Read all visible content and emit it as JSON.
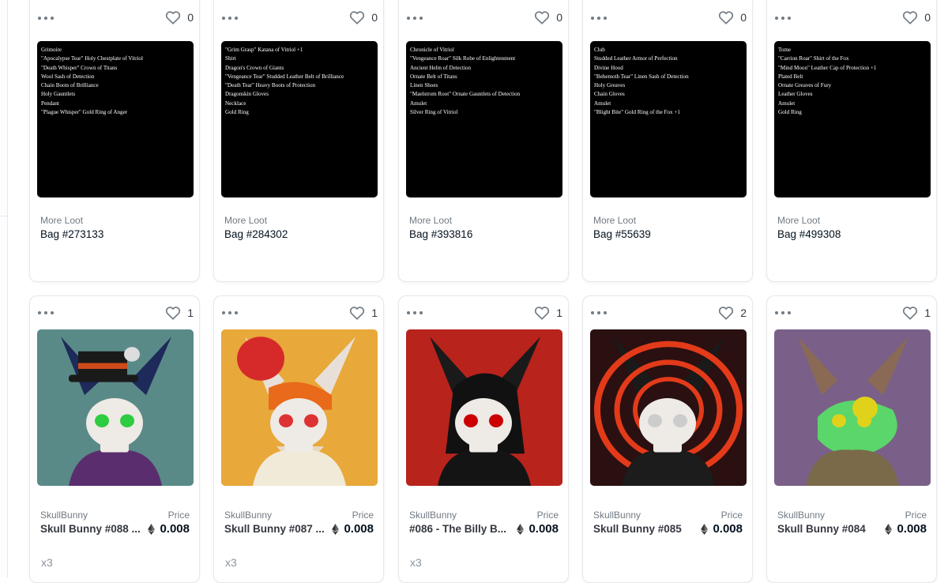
{
  "row1": [
    {
      "collection": "More Loot",
      "name": "Bag #273133",
      "likes": "0",
      "loot": [
        "Grimoire",
        "\"Apocalypse Tear\" Holy Chestplate of Vitriol",
        "\"Death Whisper\" Crown of Titans",
        "Wool Sash of Detection",
        "Chain Boots of Brilliance",
        "Holy Gauntlets",
        "Pendant",
        "\"Plague Whisper\" Gold Ring of Anger"
      ]
    },
    {
      "collection": "More Loot",
      "name": "Bag #284302",
      "likes": "0",
      "loot": [
        "\"Grim Grasp\" Katana of Vitriol +1",
        "Shirt",
        "Dragon's Crown of Giants",
        "\"Vengeance Tear\" Studded Leather Belt of Brilliance",
        "\"Death Tear\" Heavy Boots of Protection",
        "Dragonskin Gloves",
        "Necklace",
        "Gold Ring"
      ]
    },
    {
      "collection": "More Loot",
      "name": "Bag #393816",
      "likes": "0",
      "loot": [
        "Chronicle of Vitriol",
        "\"Vengeance Roar\" Silk Robe of Enlightenment",
        "Ancient Helm of Detection",
        "Ornate Belt of Titans",
        "Linen Shoes",
        "\"Maelstrom Root\" Ornate Gauntlets of Detection",
        "Amulet",
        "Silver Ring of Vitriol"
      ]
    },
    {
      "collection": "More Loot",
      "name": "Bag #55639",
      "likes": "0",
      "loot": [
        "Club",
        "Studded Leather Armor of Perfection",
        "Divine Hood",
        "\"Behemoth Tear\" Linen Sash of Detection",
        "Holy Greaves",
        "Chain Gloves",
        "Amulet",
        "\"Blight Bite\" Gold Ring of the Fox +1"
      ]
    },
    {
      "collection": "More Loot",
      "name": "Bag #499308",
      "likes": "0",
      "loot": [
        "Tome",
        "\"Carrion Roar\" Shirt of the Fox",
        "\"Mind Moon\" Leather Cap of Protection +1",
        "Plated Belt",
        "Ornate Greaves of Fury",
        "Leather Gloves",
        "Amulet",
        "Gold Ring"
      ]
    }
  ],
  "row2": [
    {
      "collection": "SkullBunny",
      "name": "Skull Bunny #088 ...",
      "likes": "1",
      "price_label": "Price",
      "price": "0.008",
      "qty": "x3",
      "bg": "#5a8a88"
    },
    {
      "collection": "SkullBunny",
      "name": "Skull Bunny #087 ...",
      "likes": "1",
      "price_label": "Price",
      "price": "0.008",
      "qty": "x3",
      "bg": "#e8a83a"
    },
    {
      "collection": "SkullBunny",
      "name": "#086 - The Billy B...",
      "likes": "1",
      "price_label": "Price",
      "price": "0.008",
      "qty": "x3",
      "bg": "#b8231c"
    },
    {
      "collection": "SkullBunny",
      "name": "Skull Bunny #085",
      "likes": "2",
      "price_label": "Price",
      "price": "0.008",
      "qty": "",
      "bg": "#2a1010"
    },
    {
      "collection": "SkullBunny",
      "name": "Skull Bunny #084",
      "likes": "1",
      "price_label": "Price",
      "price": "0.008",
      "qty": "",
      "bg": "#7a6088"
    }
  ],
  "icons": {
    "more": "more-horizontal-icon",
    "favorite": "heart-outline-icon",
    "currency": "ethereum-icon"
  }
}
